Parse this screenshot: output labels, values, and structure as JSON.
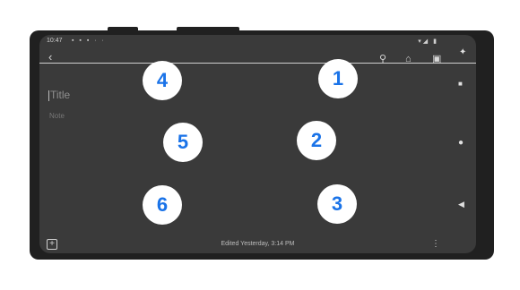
{
  "status": {
    "time": "10:47",
    "left_icons": "▪ ▪ ▪ · ·",
    "right_icons": "▾◢ ▮"
  },
  "toolbar": {
    "back_glyph": "‹",
    "pin_glyph": "⚲",
    "reminder_glyph": "⌂",
    "archive_glyph": "▣"
  },
  "note": {
    "title_placeholder": "Title",
    "body_placeholder": "Note"
  },
  "bottom": {
    "add_glyph": "+",
    "edited_text": "Edited Yesterday, 3:14 PM",
    "more_glyph": "⋮"
  },
  "side": {
    "accessibility_glyph": "✦",
    "square_glyph": "■",
    "circle_glyph": "●",
    "back_glyph": "◀"
  },
  "markers": [
    "1",
    "2",
    "3",
    "4",
    "5",
    "6"
  ],
  "colors": {
    "marker_text": "#1a73e8",
    "marker_bg": "#ffffff",
    "screen_bg": "#3a3a3a"
  }
}
